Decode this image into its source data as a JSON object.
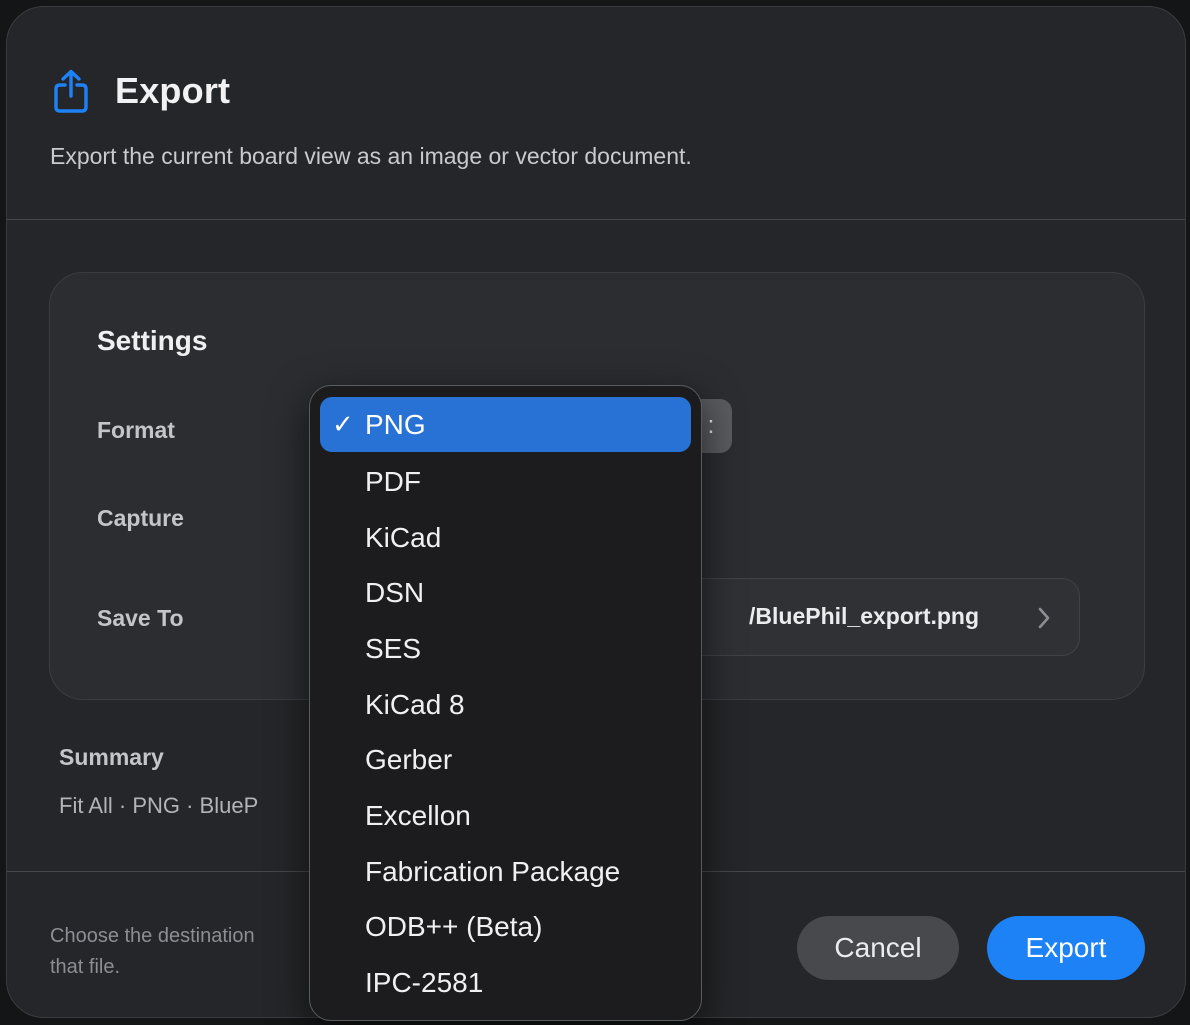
{
  "dialog": {
    "title": "Export",
    "title_icon": "share-icon",
    "subtitle": "Export the current board view as an image or vector document.",
    "accent_color": "#1e82f7"
  },
  "settings": {
    "title": "Settings",
    "format_label": "Format",
    "format_value": "PNG",
    "format_stepper_glyph": ":",
    "capture_label": "Capture",
    "save_to_label": "Save To",
    "save_to_path": "/BluePhil_export.png",
    "save_to_icon": "chevron-right-icon"
  },
  "summary": {
    "title": "Summary",
    "text": "Fit All · PNG · BlueP"
  },
  "footer": {
    "hint_line1": "Choose the destination",
    "hint_line2": "that file.",
    "cancel_label": "Cancel",
    "export_label": "Export"
  },
  "format_menu": {
    "check_glyph": "✓",
    "selected": "PNG",
    "options": [
      "PNG",
      "PDF",
      "KiCad",
      "DSN",
      "SES",
      "KiCad 8",
      "Gerber",
      "Excellon",
      "Fabrication Package",
      "ODB++ (Beta)",
      "IPC-2581"
    ]
  }
}
